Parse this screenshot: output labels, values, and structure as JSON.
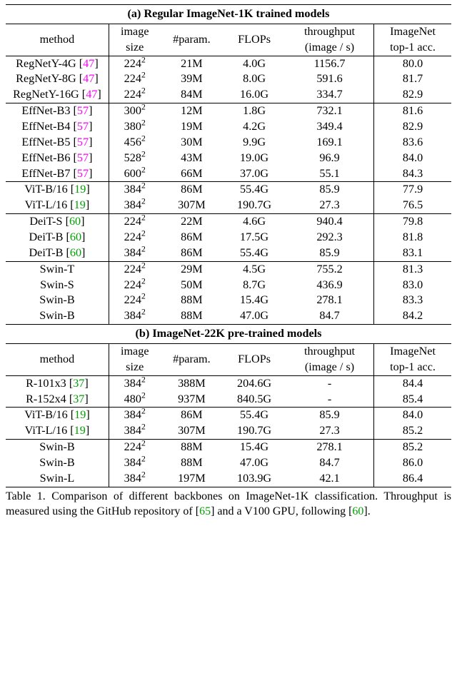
{
  "chart_data": [
    {
      "type": "table",
      "title": "(a) Regular ImageNet-1K trained models",
      "columns": [
        "method",
        "image size",
        "#param.",
        "FLOPs",
        "throughput (image / s)",
        "ImageNet top-1 acc."
      ],
      "rows": [
        [
          "RegNetY-4G [47]",
          "224^2",
          "21M",
          "4.0G",
          "1156.7",
          "80.0"
        ],
        [
          "RegNetY-8G [47]",
          "224^2",
          "39M",
          "8.0G",
          "591.6",
          "81.7"
        ],
        [
          "RegNetY-16G [47]",
          "224^2",
          "84M",
          "16.0G",
          "334.7",
          "82.9"
        ],
        [
          "EffNet-B3 [57]",
          "300^2",
          "12M",
          "1.8G",
          "732.1",
          "81.6"
        ],
        [
          "EffNet-B4 [57]",
          "380^2",
          "19M",
          "4.2G",
          "349.4",
          "82.9"
        ],
        [
          "EffNet-B5 [57]",
          "456^2",
          "30M",
          "9.9G",
          "169.1",
          "83.6"
        ],
        [
          "EffNet-B6 [57]",
          "528^2",
          "43M",
          "19.0G",
          "96.9",
          "84.0"
        ],
        [
          "EffNet-B7 [57]",
          "600^2",
          "66M",
          "37.0G",
          "55.1",
          "84.3"
        ],
        [
          "ViT-B/16 [19]",
          "384^2",
          "86M",
          "55.4G",
          "85.9",
          "77.9"
        ],
        [
          "ViT-L/16 [19]",
          "384^2",
          "307M",
          "190.7G",
          "27.3",
          "76.5"
        ],
        [
          "DeiT-S [60]",
          "224^2",
          "22M",
          "4.6G",
          "940.4",
          "79.8"
        ],
        [
          "DeiT-B [60]",
          "224^2",
          "86M",
          "17.5G",
          "292.3",
          "81.8"
        ],
        [
          "DeiT-B [60]",
          "384^2",
          "86M",
          "55.4G",
          "85.9",
          "83.1"
        ],
        [
          "Swin-T",
          "224^2",
          "29M",
          "4.5G",
          "755.2",
          "81.3"
        ],
        [
          "Swin-S",
          "224^2",
          "50M",
          "8.7G",
          "436.9",
          "83.0"
        ],
        [
          "Swin-B",
          "224^2",
          "88M",
          "15.4G",
          "278.1",
          "83.3"
        ],
        [
          "Swin-B",
          "384^2",
          "88M",
          "47.0G",
          "84.7",
          "84.2"
        ]
      ]
    },
    {
      "type": "table",
      "title": "(b) ImageNet-22K pre-trained models",
      "columns": [
        "method",
        "image size",
        "#param.",
        "FLOPs",
        "throughput (image / s)",
        "ImageNet top-1 acc."
      ],
      "rows": [
        [
          "R-101x3 [37]",
          "384^2",
          "388M",
          "204.6G",
          "-",
          "84.4"
        ],
        [
          "R-152x4 [37]",
          "480^2",
          "937M",
          "840.5G",
          "-",
          "85.4"
        ],
        [
          "ViT-B/16 [19]",
          "384^2",
          "86M",
          "55.4G",
          "85.9",
          "84.0"
        ],
        [
          "ViT-L/16 [19]",
          "384^2",
          "307M",
          "190.7G",
          "27.3",
          "85.2"
        ],
        [
          "Swin-B",
          "224^2",
          "88M",
          "15.4G",
          "278.1",
          "85.2"
        ],
        [
          "Swin-B",
          "384^2",
          "88M",
          "47.0G",
          "84.7",
          "86.0"
        ],
        [
          "Swin-L",
          "384^2",
          "197M",
          "103.9G",
          "42.1",
          "86.4"
        ]
      ]
    }
  ],
  "tableA": {
    "title": "(a) Regular ImageNet-1K trained models",
    "headers": {
      "method": "method",
      "img1": "image",
      "img2": "size",
      "param": "#param.",
      "flops": "FLOPs",
      "thru1": "throughput",
      "thru2": "(image / s)",
      "acc1": "ImageNet",
      "acc2": "top-1 acc."
    },
    "rows": [
      {
        "m": "RegNetY-4G ",
        "c": "47",
        "cc": "cite2",
        "sz": "224",
        "p": "21M",
        "f": "4.0G",
        "t": "1156.7",
        "a": "80.0",
        "end": false
      },
      {
        "m": "RegNetY-8G ",
        "c": "47",
        "cc": "cite2",
        "sz": "224",
        "p": "39M",
        "f": "8.0G",
        "t": "591.6",
        "a": "81.7",
        "end": false
      },
      {
        "m": "RegNetY-16G ",
        "c": "47",
        "cc": "cite2",
        "sz": "224",
        "p": "84M",
        "f": "16.0G",
        "t": "334.7",
        "a": "82.9",
        "end": true
      },
      {
        "m": "EffNet-B3 ",
        "c": "57",
        "cc": "cite2",
        "sz": "300",
        "p": "12M",
        "f": "1.8G",
        "t": "732.1",
        "a": "81.6",
        "end": false
      },
      {
        "m": "EffNet-B4 ",
        "c": "57",
        "cc": "cite2",
        "sz": "380",
        "p": "19M",
        "f": "4.2G",
        "t": "349.4",
        "a": "82.9",
        "end": false
      },
      {
        "m": "EffNet-B5 ",
        "c": "57",
        "cc": "cite2",
        "sz": "456",
        "p": "30M",
        "f": "9.9G",
        "t": "169.1",
        "a": "83.6",
        "end": false
      },
      {
        "m": "EffNet-B6 ",
        "c": "57",
        "cc": "cite2",
        "sz": "528",
        "p": "43M",
        "f": "19.0G",
        "t": "96.9",
        "a": "84.0",
        "end": false
      },
      {
        "m": "EffNet-B7 ",
        "c": "57",
        "cc": "cite2",
        "sz": "600",
        "p": "66M",
        "f": "37.0G",
        "t": "55.1",
        "a": "84.3",
        "end": true
      },
      {
        "m": "ViT-B/16 ",
        "c": "19",
        "cc": "cite",
        "sz": "384",
        "p": "86M",
        "f": "55.4G",
        "t": "85.9",
        "a": "77.9",
        "end": false
      },
      {
        "m": "ViT-L/16 ",
        "c": "19",
        "cc": "cite",
        "sz": "384",
        "p": "307M",
        "f": "190.7G",
        "t": "27.3",
        "a": "76.5",
        "end": true
      },
      {
        "m": "DeiT-S ",
        "c": "60",
        "cc": "cite",
        "sz": "224",
        "p": "22M",
        "f": "4.6G",
        "t": "940.4",
        "a": "79.8",
        "end": false
      },
      {
        "m": "DeiT-B ",
        "c": "60",
        "cc": "cite",
        "sz": "224",
        "p": "86M",
        "f": "17.5G",
        "t": "292.3",
        "a": "81.8",
        "end": false
      },
      {
        "m": "DeiT-B ",
        "c": "60",
        "cc": "cite",
        "sz": "384",
        "p": "86M",
        "f": "55.4G",
        "t": "85.9",
        "a": "83.1",
        "end": true
      },
      {
        "m": "Swin-T",
        "c": "",
        "cc": "",
        "sz": "224",
        "p": "29M",
        "f": "4.5G",
        "t": "755.2",
        "a": "81.3",
        "end": false
      },
      {
        "m": "Swin-S",
        "c": "",
        "cc": "",
        "sz": "224",
        "p": "50M",
        "f": "8.7G",
        "t": "436.9",
        "a": "83.0",
        "end": false
      },
      {
        "m": "Swin-B",
        "c": "",
        "cc": "",
        "sz": "224",
        "p": "88M",
        "f": "15.4G",
        "t": "278.1",
        "a": "83.3",
        "end": false
      },
      {
        "m": "Swin-B",
        "c": "",
        "cc": "",
        "sz": "384",
        "p": "88M",
        "f": "47.0G",
        "t": "84.7",
        "a": "84.2",
        "end": false,
        "heavy": true
      }
    ]
  },
  "tableB": {
    "title": "(b) ImageNet-22K pre-trained models",
    "headers": {
      "method": "method",
      "img1": "image",
      "img2": "size",
      "param": "#param.",
      "flops": "FLOPs",
      "thru1": "throughput",
      "thru2": "(image / s)",
      "acc1": "ImageNet",
      "acc2": "top-1 acc."
    },
    "rows": [
      {
        "m": "R-101x3 ",
        "c": "37",
        "cc": "cite",
        "sz": "384",
        "p": "388M",
        "f": "204.6G",
        "t": "-",
        "a": "84.4",
        "end": false
      },
      {
        "m": "R-152x4 ",
        "c": "37",
        "cc": "cite",
        "sz": "480",
        "p": "937M",
        "f": "840.5G",
        "t": "-",
        "a": "85.4",
        "end": true
      },
      {
        "m": "ViT-B/16 ",
        "c": "19",
        "cc": "cite",
        "sz": "384",
        "p": "86M",
        "f": "55.4G",
        "t": "85.9",
        "a": "84.0",
        "end": false
      },
      {
        "m": "ViT-L/16 ",
        "c": "19",
        "cc": "cite",
        "sz": "384",
        "p": "307M",
        "f": "190.7G",
        "t": "27.3",
        "a": "85.2",
        "end": true
      },
      {
        "m": "Swin-B",
        "c": "",
        "cc": "",
        "sz": "224",
        "p": "88M",
        "f": "15.4G",
        "t": "278.1",
        "a": "85.2",
        "end": false
      },
      {
        "m": "Swin-B",
        "c": "",
        "cc": "",
        "sz": "384",
        "p": "88M",
        "f": "47.0G",
        "t": "84.7",
        "a": "86.0",
        "end": false
      },
      {
        "m": "Swin-L",
        "c": "",
        "cc": "",
        "sz": "384",
        "p": "197M",
        "f": "103.9G",
        "t": "42.1",
        "a": "86.4",
        "end": false,
        "heavy": true
      }
    ]
  },
  "caption": {
    "pre": "Table 1. Comparison of different backbones on ImageNet-1K classification. Throughput is measured using the GitHub repository of [",
    "c1": "65",
    "mid": "] and a V100 GPU, following [",
    "c2": "60",
    "post": "]."
  }
}
